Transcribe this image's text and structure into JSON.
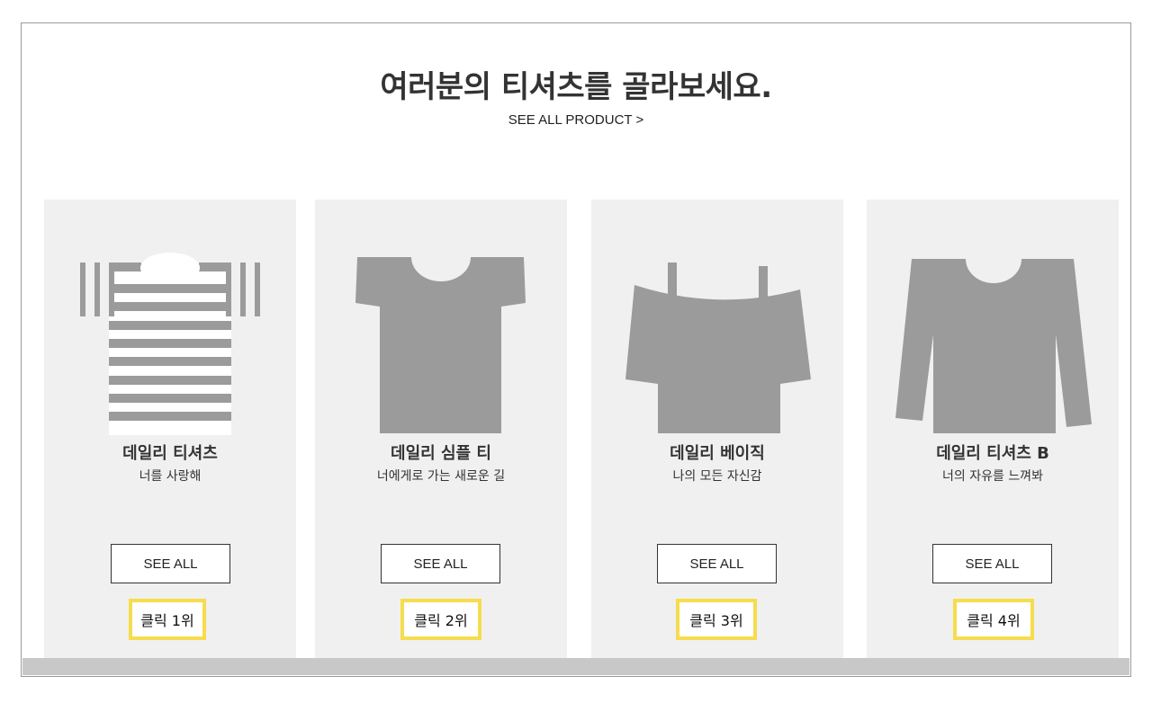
{
  "header": {
    "title": "여러분의 티셔츠를 골라보세요.",
    "see_all_product": "SEE ALL PRODUCT >"
  },
  "products": [
    {
      "name": "데일리 티셔츠",
      "desc": "너를 사랑해",
      "button": "SEE ALL",
      "rank": "클릭 1위",
      "icon": "striped-tshirt-icon"
    },
    {
      "name": "데일리 심플 티",
      "desc": "너에게로 가는 새로운 길",
      "button": "SEE ALL",
      "rank": "클릭 2위",
      "icon": "plain-tshirt-icon"
    },
    {
      "name": "데일리 베이직",
      "desc": "나의 모든 자신감",
      "button": "SEE ALL",
      "rank": "클릭 3위",
      "icon": "off-shoulder-top-icon"
    },
    {
      "name": "데일리 티셔츠 B",
      "desc": "너의 자유를 느껴봐",
      "button": "SEE ALL",
      "rank": "클릭 4위",
      "icon": "long-sleeve-tshirt-icon"
    }
  ],
  "colors": {
    "card_bg": "#f0f0f0",
    "shirt_gray": "#9b9b9b",
    "rank_highlight": "#f6dc4e",
    "footer_strip": "#c8c8c8"
  }
}
